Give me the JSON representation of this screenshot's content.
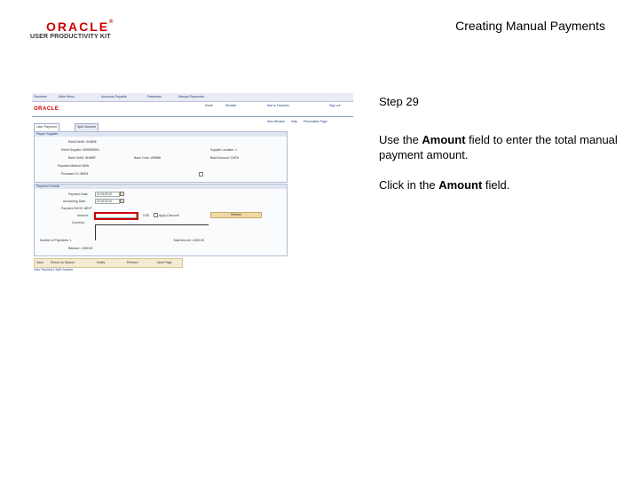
{
  "header": {
    "logo": "ORACLE",
    "logo_mark": "®",
    "logo_sub": "USER PRODUCTIVITY KIT",
    "title": "Creating Manual Payments"
  },
  "instructions": {
    "step": "Step 29",
    "line1_pre": "Use the ",
    "line1_bold": "Amount",
    "line1_post": " field to enter the total manual payment amount.",
    "line2_pre": "Click in the ",
    "line2_bold": "Amount",
    "line2_post": " field."
  },
  "screenshot": {
    "nav": [
      "Favorites",
      "Main Menu",
      "Accounts Payable",
      "Payments",
      "Manual Payments"
    ],
    "brand": "ORACLE",
    "right_links": [
      "Home",
      "Worklist",
      "Add to Favorites",
      "Sign out"
    ],
    "page_links": [
      "New Window",
      "Help",
      "Personalize Page"
    ],
    "tabs": [
      "User Payment",
      "Split Voucher"
    ],
    "section_payee": "Payee Supplier",
    "payee_fields": [
      {
        "label": "Remit SetID:",
        "value": "SHARE"
      },
      {
        "label": "Remit Supplier:",
        "value": "0000000001"
      },
      {
        "label": "Bank SetID:",
        "value": "SHARE"
      },
      {
        "label": "Payment Method:",
        "value": "MAN"
      },
      {
        "label": "Processor ID:",
        "value": "MN01"
      }
    ],
    "payee_right": [
      {
        "label": "Supplier Location:",
        "value": "1"
      },
      {
        "label": "Bank Code:",
        "value": "USBNK"
      },
      {
        "label": "Bank Account:",
        "value": "CHCK"
      }
    ],
    "section_payment": "Payment Details",
    "payment_fields": [
      {
        "label": "Payment Date:",
        "value": "01/01/2010"
      },
      {
        "label": "Accounting Date:",
        "value": "01/01/2010"
      },
      {
        "label": "Payment Ref ID:",
        "value": "NEXT"
      },
      {
        "label": "Amount:",
        "value": ""
      },
      {
        "label": "Currency:",
        "value": "USD"
      }
    ],
    "apply_label": "Apply Discount",
    "refresh_label": "Refresh",
    "number_payments_label": "Number of Payments:",
    "number_payments": "1",
    "total_label": "Total Amount:",
    "total_value": "1,500.00",
    "balance_label": "Balance:",
    "balance_value": "1,500.00",
    "bottom": [
      "Save",
      "Return to Search",
      "Notify",
      "Refresh",
      "Next Page"
    ],
    "status": "User Payment | Split Voucher"
  }
}
